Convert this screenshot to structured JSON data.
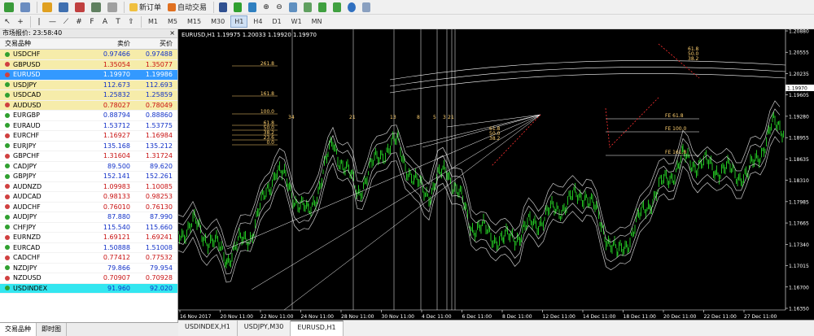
{
  "toolbar": {
    "new_order_label": "新订单",
    "auto_trade_label": "自动交易",
    "timeframes": [
      "M1",
      "M5",
      "M15",
      "M30",
      "H1",
      "H4",
      "D1",
      "W1",
      "MN"
    ],
    "active_timeframe": "H1"
  },
  "market_watch": {
    "title": "市场报价: 23:58:40",
    "headers": {
      "symbol": "交易品种",
      "bid": "卖价",
      "ask": "买价"
    },
    "rows": [
      {
        "symbol": "USDCHF",
        "bid": "0.97466",
        "ask": "0.97488",
        "bg": "yellow",
        "dir": "up"
      },
      {
        "symbol": "GBPUSD",
        "bid": "1.35054",
        "ask": "1.35077",
        "bg": "yellow",
        "dir": "down"
      },
      {
        "symbol": "EURUSD",
        "bid": "1.19970",
        "ask": "1.19986",
        "bg": "selected",
        "dir": "down"
      },
      {
        "symbol": "USDJPY",
        "bid": "112.673",
        "ask": "112.693",
        "bg": "yellow",
        "dir": "up"
      },
      {
        "symbol": "USDCAD",
        "bid": "1.25832",
        "ask": "1.25859",
        "bg": "yellow",
        "dir": "up"
      },
      {
        "symbol": "AUDUSD",
        "bid": "0.78027",
        "ask": "0.78049",
        "bg": "yellow",
        "dir": "down"
      },
      {
        "symbol": "EURGBP",
        "bid": "0.88794",
        "ask": "0.88860",
        "bg": "white",
        "dir": "up"
      },
      {
        "symbol": "EURAUD",
        "bid": "1.53712",
        "ask": "1.53775",
        "bg": "white",
        "dir": "up"
      },
      {
        "symbol": "EURCHF",
        "bid": "1.16927",
        "ask": "1.16984",
        "bg": "white",
        "dir": "down"
      },
      {
        "symbol": "EURJPY",
        "bid": "135.168",
        "ask": "135.212",
        "bg": "white",
        "dir": "up"
      },
      {
        "symbol": "GBPCHF",
        "bid": "1.31604",
        "ask": "1.31724",
        "bg": "white",
        "dir": "down"
      },
      {
        "symbol": "CADJPY",
        "bid": "89.500",
        "ask": "89.620",
        "bg": "white",
        "dir": "up"
      },
      {
        "symbol": "GBPJPY",
        "bid": "152.141",
        "ask": "152.261",
        "bg": "white",
        "dir": "up"
      },
      {
        "symbol": "AUDNZD",
        "bid": "1.09983",
        "ask": "1.10085",
        "bg": "white",
        "dir": "down"
      },
      {
        "symbol": "AUDCAD",
        "bid": "0.98133",
        "ask": "0.98253",
        "bg": "white",
        "dir": "down"
      },
      {
        "symbol": "AUDCHF",
        "bid": "0.76010",
        "ask": "0.76130",
        "bg": "white",
        "dir": "down"
      },
      {
        "symbol": "AUDJPY",
        "bid": "87.880",
        "ask": "87.990",
        "bg": "white",
        "dir": "up"
      },
      {
        "symbol": "CHFJPY",
        "bid": "115.540",
        "ask": "115.660",
        "bg": "white",
        "dir": "up"
      },
      {
        "symbol": "EURNZD",
        "bid": "1.69121",
        "ask": "1.69241",
        "bg": "white",
        "dir": "down"
      },
      {
        "symbol": "EURCAD",
        "bid": "1.50888",
        "ask": "1.51008",
        "bg": "white",
        "dir": "up"
      },
      {
        "symbol": "CADCHF",
        "bid": "0.77412",
        "ask": "0.77532",
        "bg": "white",
        "dir": "down"
      },
      {
        "symbol": "NZDJPY",
        "bid": "79.866",
        "ask": "79.954",
        "bg": "white",
        "dir": "up"
      },
      {
        "symbol": "NZDUSD",
        "bid": "0.70907",
        "ask": "0.70928",
        "bg": "white",
        "dir": "down"
      },
      {
        "symbol": "USDINDEX",
        "bid": "91.960",
        "ask": "92.020",
        "bg": "cyan",
        "dir": "up"
      }
    ],
    "tabs": [
      "交易品种",
      "即时图"
    ]
  },
  "chart": {
    "header": "EURUSD,H1  1.19975 1.20033 1.19920 1.19970",
    "current_price": "1.19970",
    "price_labels": [
      "1.20880",
      "1.20555",
      "1.20235",
      "1.19605",
      "1.19280",
      "1.18955",
      "1.18635",
      "1.18310",
      "1.17985",
      "1.17665",
      "1.17340",
      "1.17015",
      "1.16700",
      "1.16350"
    ],
    "time_labels": [
      "16 Nov 2017",
      "20 Nov 11:00",
      "22 Nov 11:00",
      "24 Nov 11:00",
      "28 Nov 11:00",
      "30 Nov 11:00",
      "4 Dec 11:00",
      "6 Dec 11:00",
      "8 Dec 11:00",
      "12 Dec 11:00",
      "14 Dec 11:00",
      "18 Dec 11:00",
      "20 Dec 11:00",
      "22 Dec 11:00",
      "27 Dec 11:00"
    ],
    "fib_levels": [
      "261.8",
      "161.8",
      "100.0",
      "61.8",
      "50.0",
      "38.2",
      "23.6",
      "0.0"
    ],
    "fan_labels": [
      "61.8",
      "50.0",
      "38.2"
    ],
    "fan_labels_top": [
      "61.8",
      "50.0",
      "38.2"
    ],
    "fe_labels": [
      "FE 61.8",
      "FE 100.0",
      "FE 161.8"
    ],
    "period_labels": [
      "34",
      "21",
      "13",
      "8",
      "5",
      "3",
      "2",
      "1"
    ],
    "colors": {
      "candle": "#22c022",
      "band": "#c8c8c8",
      "fib": "#ffd070",
      "grid": "#1a1a1a",
      "axis": "#ffffff"
    }
  },
  "chart_tabs": [
    "USDINDEX,H1",
    "USDJPY,M30",
    "EURUSD,H1"
  ],
  "active_chart_tab": "EURUSD,H1"
}
